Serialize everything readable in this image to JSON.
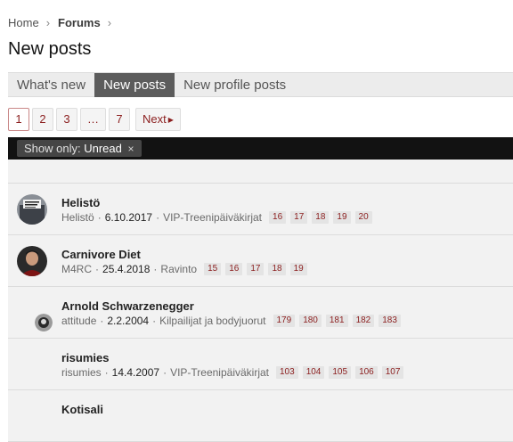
{
  "breadcrumb": {
    "home": "Home",
    "forums": "Forums"
  },
  "page_title": "New posts",
  "tabs": [
    {
      "label": "What's new",
      "active": false
    },
    {
      "label": "New posts",
      "active": true
    },
    {
      "label": "New profile posts",
      "active": false
    }
  ],
  "pagination": {
    "pages": [
      "1",
      "2",
      "3",
      "…",
      "7"
    ],
    "current": "1",
    "next": "Next"
  },
  "filter": {
    "label": "Show only:",
    "value": "Unread",
    "remove": "×"
  },
  "threads": [
    {
      "title": "Helistö",
      "author": "Helistö",
      "date": "6.10.2017",
      "forum": "VIP-Treenipäiväkirjat",
      "pages": [
        "16",
        "17",
        "18",
        "19",
        "20"
      ]
    },
    {
      "title": "Carnivore Diet",
      "author": "M4RC",
      "date": "25.4.2018",
      "forum": "Ravinto",
      "pages": [
        "15",
        "16",
        "17",
        "18",
        "19"
      ]
    },
    {
      "title": "Arnold Schwarzenegger",
      "author": "attitude",
      "date": "2.2.2004",
      "forum": "Kilpailijat ja bodyjuorut",
      "pages": [
        "179",
        "180",
        "181",
        "182",
        "183"
      ]
    },
    {
      "title": "risumies",
      "author": "risumies",
      "date": "14.4.2007",
      "forum": "VIP-Treenipäiväkirjat",
      "pages": [
        "103",
        "104",
        "105",
        "106",
        "107"
      ]
    },
    {
      "title": "Kotisali",
      "author": "",
      "date": "",
      "forum": "",
      "pages": []
    }
  ],
  "colors": {
    "accent": "#8b1e1e",
    "tab_active": "#5c5c5c",
    "filter_bar": "#121212"
  }
}
